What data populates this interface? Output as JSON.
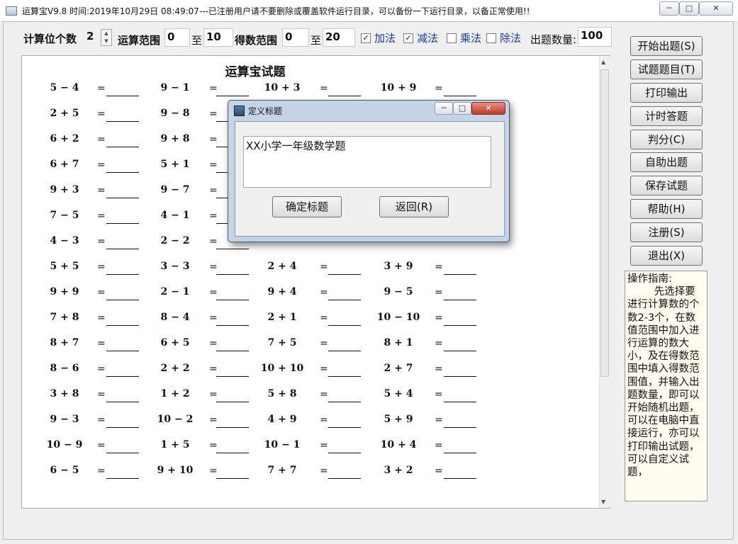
{
  "window": {
    "title": "运算宝V9.8  时间:2019年10月29日 08:49:07---已注册用户请不要删除或覆盖软件运行目录，可以备份一下运行目录，以备正常使用!!",
    "minimize": "─",
    "restore": "□",
    "close": "✕"
  },
  "toolbar": {
    "digits_label": "计算位个数",
    "digits_value": "2",
    "range_label": "运算范围",
    "range_from": "0",
    "to1": "至",
    "range_to": "10",
    "result_label": "得数范围",
    "result_from": "0",
    "to2": "至",
    "result_to": "20",
    "add_label": "加法",
    "sub_label": "减法",
    "mul_label": "乘法",
    "div_label": "除法",
    "count_label": "出题数量:",
    "count_value": "100",
    "check_mark": "✓"
  },
  "sheet": {
    "title": "运算宝试题",
    "eq": "="
  },
  "problems": [
    "5 − 4",
    "9 − 1",
    "10 + 3",
    "10 + 9",
    "2 + 5",
    "9 − 8",
    "",
    "",
    "6 + 2",
    "9 + 8",
    "",
    "",
    "6 + 7",
    "5 + 1",
    "",
    "",
    "9 + 3",
    "9 − 7",
    "",
    "",
    "7 − 5",
    "4 − 1",
    "",
    "",
    "4 − 3",
    "2 − 2",
    "",
    "",
    "5 + 5",
    "3 − 3",
    "2 + 4",
    "3 + 9",
    "9 + 9",
    "2 − 1",
    "9 + 4",
    "9 − 5",
    "7 + 8",
    "8 − 4",
    "2 + 1",
    "10 − 10",
    "8 + 7",
    "6 + 5",
    "7 + 5",
    "8 + 1",
    "8 − 6",
    "2 + 2",
    "10 + 10",
    "2 + 7",
    "3 + 8",
    "1 + 2",
    "5 + 8",
    "5 + 4",
    "9 − 3",
    "10 − 2",
    "4 + 9",
    "5 + 9",
    "10 − 9",
    "1 + 5",
    "10 − 1",
    "10 + 4",
    "6 − 5",
    "9 + 10",
    "7 + 7",
    "3 + 2"
  ],
  "side_buttons": [
    "开始出题(S)",
    "试题题目(T)",
    "打印输出",
    "计时答题",
    "判分(C)",
    "自助出题",
    "保存试题",
    "帮助(H)",
    "注册(S)",
    "退出(X)"
  ],
  "guide": {
    "title": "操作指南:",
    "body": "先选择要进行计算数的个数2-3个，在数值范围中加入进行运算的数大小，及在得数范围中填入得数范围值，并输入出题数量，即可以开始随机出题，可以在电脑中直接运行，亦可以打印输出试题，可以自定义试题，"
  },
  "dialog": {
    "title": "定义标题",
    "text": "XX小学一年级数学题",
    "confirm": "确定标题",
    "back": "返回(R)",
    "minimize": "─",
    "restore": "□",
    "close": "✕"
  }
}
